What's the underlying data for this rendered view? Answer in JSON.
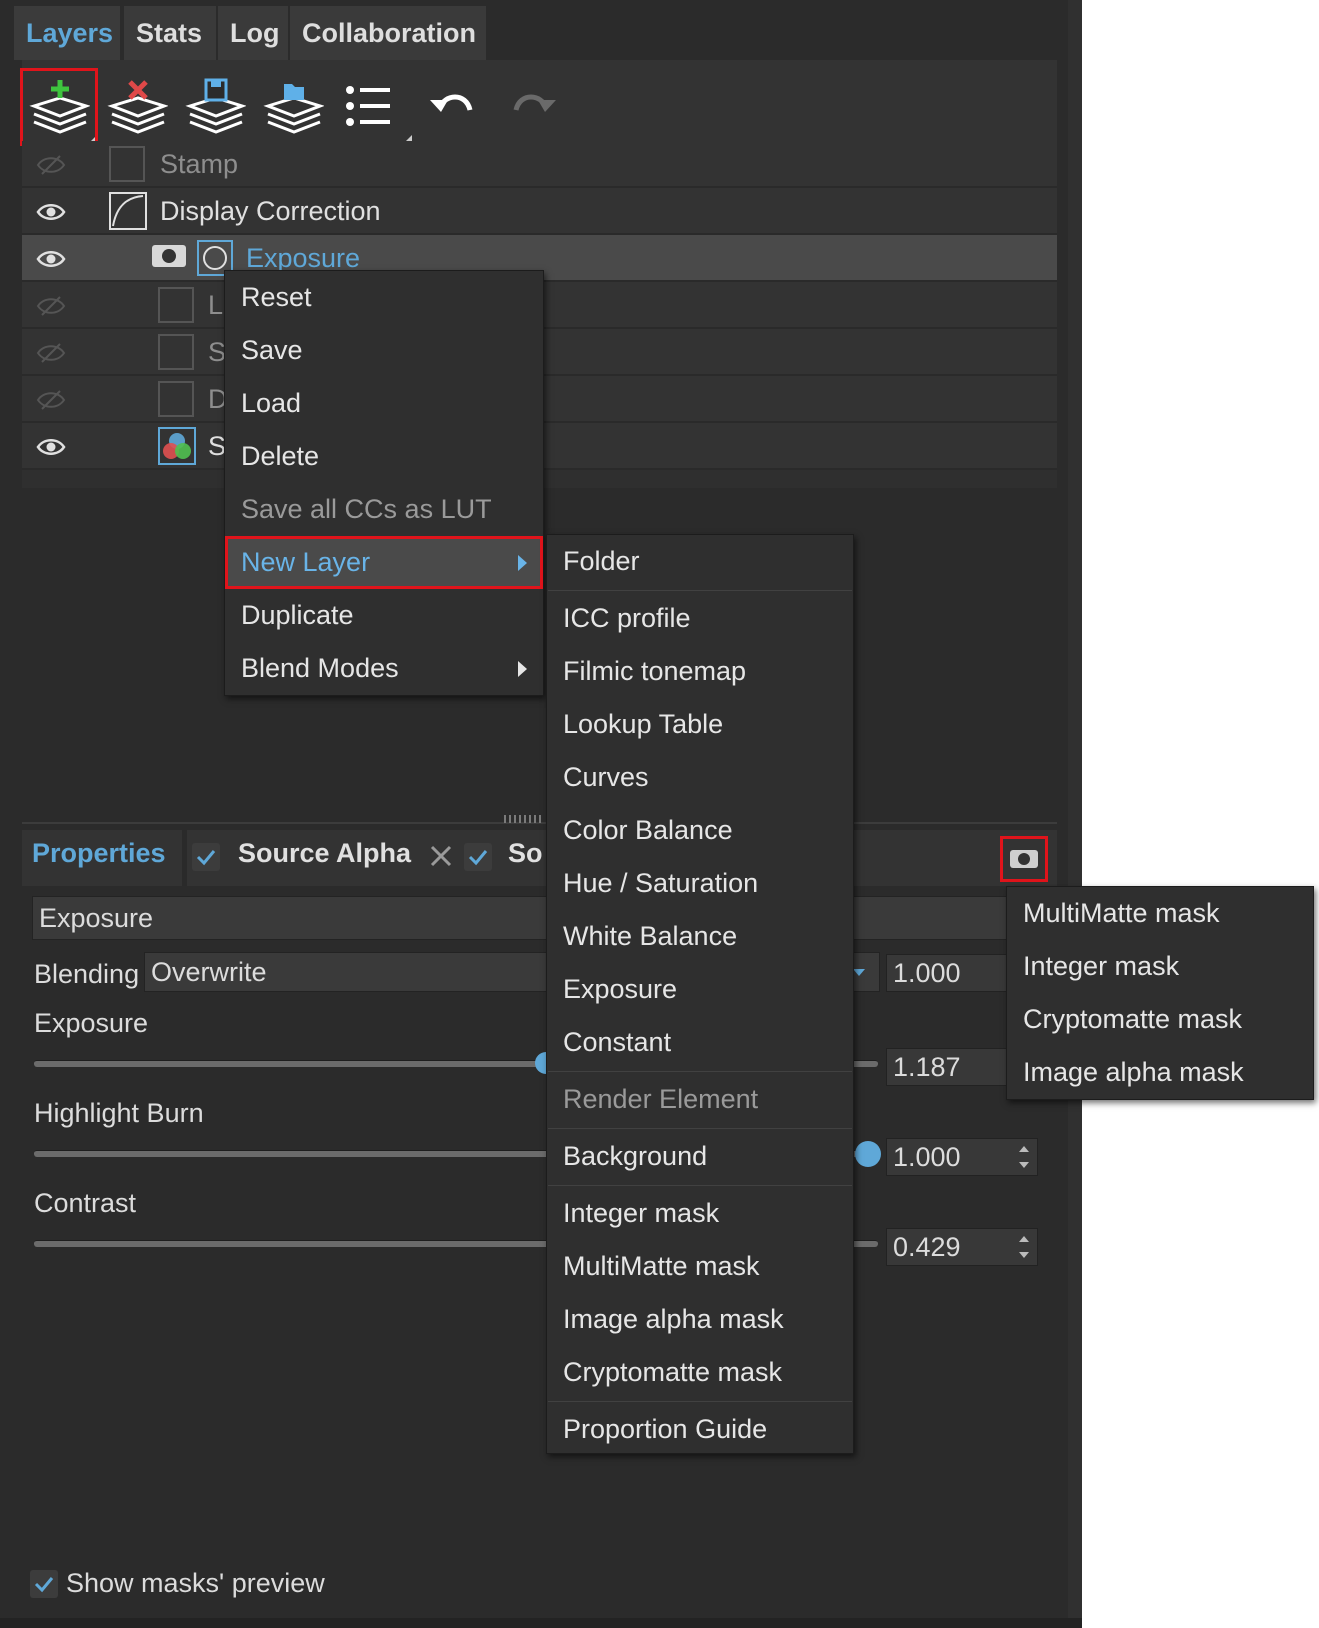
{
  "tabs": [
    "Layers",
    "Stats",
    "Log",
    "Collaboration"
  ],
  "toolbar": {
    "icons": [
      "add-layer-icon",
      "delete-layer-icon",
      "save-layer-icon",
      "load-layer-icon",
      "list-icon",
      "undo-icon",
      "redo-icon"
    ]
  },
  "layers": [
    {
      "label": "Stamp",
      "visible": false
    },
    {
      "label": "Display Correction",
      "visible": true
    },
    {
      "label": "Exposure",
      "visible": true,
      "selected": true
    },
    {
      "label": "L",
      "visible": false
    },
    {
      "label": "S",
      "visible": false
    },
    {
      "label": "D",
      "visible": false
    },
    {
      "label": "S",
      "visible": true
    }
  ],
  "context_menu": {
    "items": [
      "Reset",
      "Save",
      "Load",
      "Delete",
      "Save all CCs as LUT",
      "New Layer",
      "Duplicate",
      "Blend Modes"
    ]
  },
  "new_layer_menu": {
    "items": [
      "Folder",
      "ICC profile",
      "Filmic tonemap",
      "Lookup Table",
      "Curves",
      "Color Balance",
      "Hue / Saturation",
      "White Balance",
      "Exposure",
      "Constant",
      "Render Element",
      "Background",
      "Integer mask",
      "MultiMatte mask",
      "Image alpha mask",
      "Cryptomatte mask",
      "Proportion Guide"
    ]
  },
  "mask_menu": {
    "items": [
      "MultiMatte mask",
      "Integer mask",
      "Cryptomatte mask",
      "Image alpha mask"
    ]
  },
  "properties": {
    "tab": "Properties",
    "source_alpha": "Source Alpha",
    "source_partial": "So",
    "layer_name": "Exposure",
    "blending_label": "Blending",
    "blending_value": "Overwrite",
    "blending_opacity": "1.000",
    "params": [
      {
        "label": "Exposure",
        "value": "1.187"
      },
      {
        "label": "Highlight Burn",
        "value": "1.000"
      },
      {
        "label": "Contrast",
        "value": "0.429"
      }
    ],
    "show_masks_preview": "Show masks' preview"
  },
  "colors": {
    "accent": "#5fa8d8",
    "highlight_outline": "#e0141b",
    "add_green": "#3ec43e",
    "delete_red": "#e04848"
  }
}
